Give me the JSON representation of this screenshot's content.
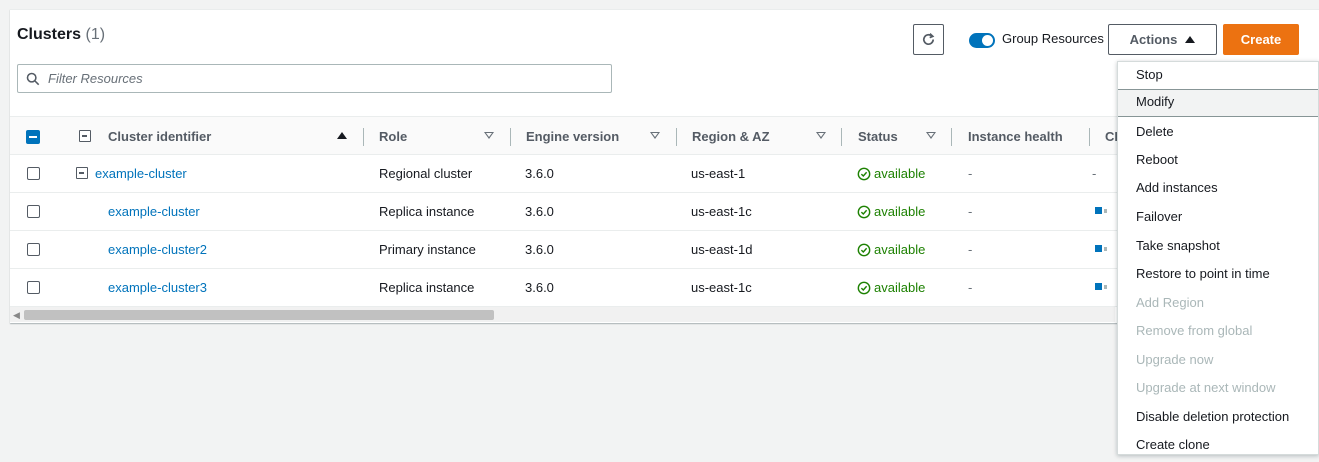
{
  "header": {
    "title": "Clusters",
    "count": "(1)",
    "group_resources_label": "Group Resources",
    "actions_label": "Actions",
    "create_label": "Create"
  },
  "filter": {
    "placeholder": "Filter Resources",
    "value": ""
  },
  "columns": {
    "cluster_identifier": "Cluster identifier",
    "role": "Role",
    "engine_version": "Engine version",
    "region_az": "Region & AZ",
    "status": "Status",
    "instance_health": "Instance health",
    "cpu_truncated": "CI"
  },
  "rows": [
    {
      "identifier": "example-cluster",
      "role": "Regional cluster",
      "engine": "3.6.0",
      "region": "us-east-1",
      "status": "available",
      "health": "-",
      "cpu": "-"
    },
    {
      "identifier": "example-cluster",
      "role": "Replica instance",
      "engine": "3.6.0",
      "region": "us-east-1c",
      "status": "available",
      "health": "-"
    },
    {
      "identifier": "example-cluster2",
      "role": "Primary instance",
      "engine": "3.6.0",
      "region": "us-east-1d",
      "status": "available",
      "health": "-"
    },
    {
      "identifier": "example-cluster3",
      "role": "Replica instance",
      "engine": "3.6.0",
      "region": "us-east-1c",
      "status": "available",
      "health": "-"
    }
  ],
  "actions_menu": [
    {
      "label": "Stop",
      "enabled": true
    },
    {
      "label": "Modify",
      "enabled": true,
      "hovered": true
    },
    {
      "label": "Delete",
      "enabled": true
    },
    {
      "label": "Reboot",
      "enabled": true
    },
    {
      "label": "Add instances",
      "enabled": true
    },
    {
      "label": "Failover",
      "enabled": true
    },
    {
      "label": "Take snapshot",
      "enabled": true
    },
    {
      "label": "Restore to point in time",
      "enabled": true
    },
    {
      "label": "Add Region",
      "enabled": false
    },
    {
      "label": "Remove from global",
      "enabled": false
    },
    {
      "label": "Upgrade now",
      "enabled": false
    },
    {
      "label": "Upgrade at next window",
      "enabled": false
    },
    {
      "label": "Disable deletion protection",
      "enabled": true
    },
    {
      "label": "Create clone",
      "enabled": true
    }
  ],
  "colors": {
    "accent": "#0073bb",
    "create_button": "#ec7211",
    "status_ok": "#1d8102",
    "disabled_text": "#aab7b8"
  },
  "icons": {
    "refresh": "refresh-icon",
    "search": "search-icon",
    "status_ok": "check-circle-icon",
    "expand_collapse": "collapse-box-icon"
  }
}
